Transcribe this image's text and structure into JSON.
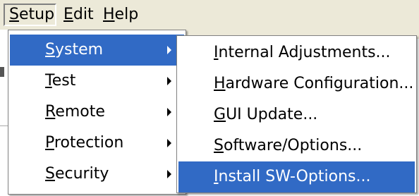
{
  "menubar": [
    {
      "name": "menu-setup",
      "mnemonic": "S",
      "rest": "etup"
    },
    {
      "name": "menu-edit",
      "mnemonic": "E",
      "rest": "dit"
    },
    {
      "name": "menu-help",
      "mnemonic": "H",
      "rest": "elp"
    }
  ],
  "setup_menu": [
    {
      "mnemonic": "S",
      "rest": "ystem",
      "submenu": true,
      "selected": true
    },
    {
      "mnemonic": "T",
      "rest": "est",
      "submenu": true,
      "selected": false
    },
    {
      "mnemonic": "R",
      "rest": "emote",
      "submenu": true,
      "selected": false
    },
    {
      "mnemonic": "P",
      "rest": "rotection",
      "submenu": true,
      "selected": false
    },
    {
      "mnemonic": "S",
      "rest": "ecurity",
      "submenu": true,
      "selected": false
    }
  ],
  "system_submenu": [
    {
      "mnemonic": "I",
      "rest": "nternal Adjustments...",
      "selected": false
    },
    {
      "mnemonic": "H",
      "rest": "ardware Configuration...",
      "selected": false
    },
    {
      "mnemonic": "G",
      "rest": "UI Update...",
      "selected": false
    },
    {
      "mnemonic": "S",
      "rest": "oftware/Options...",
      "selected": false
    },
    {
      "mnemonic": "I",
      "rest": "nstall SW-Options...",
      "selected": true
    }
  ],
  "colors": {
    "menu_highlight": "#316ac5",
    "menubar_bg": "#ece9d8"
  }
}
